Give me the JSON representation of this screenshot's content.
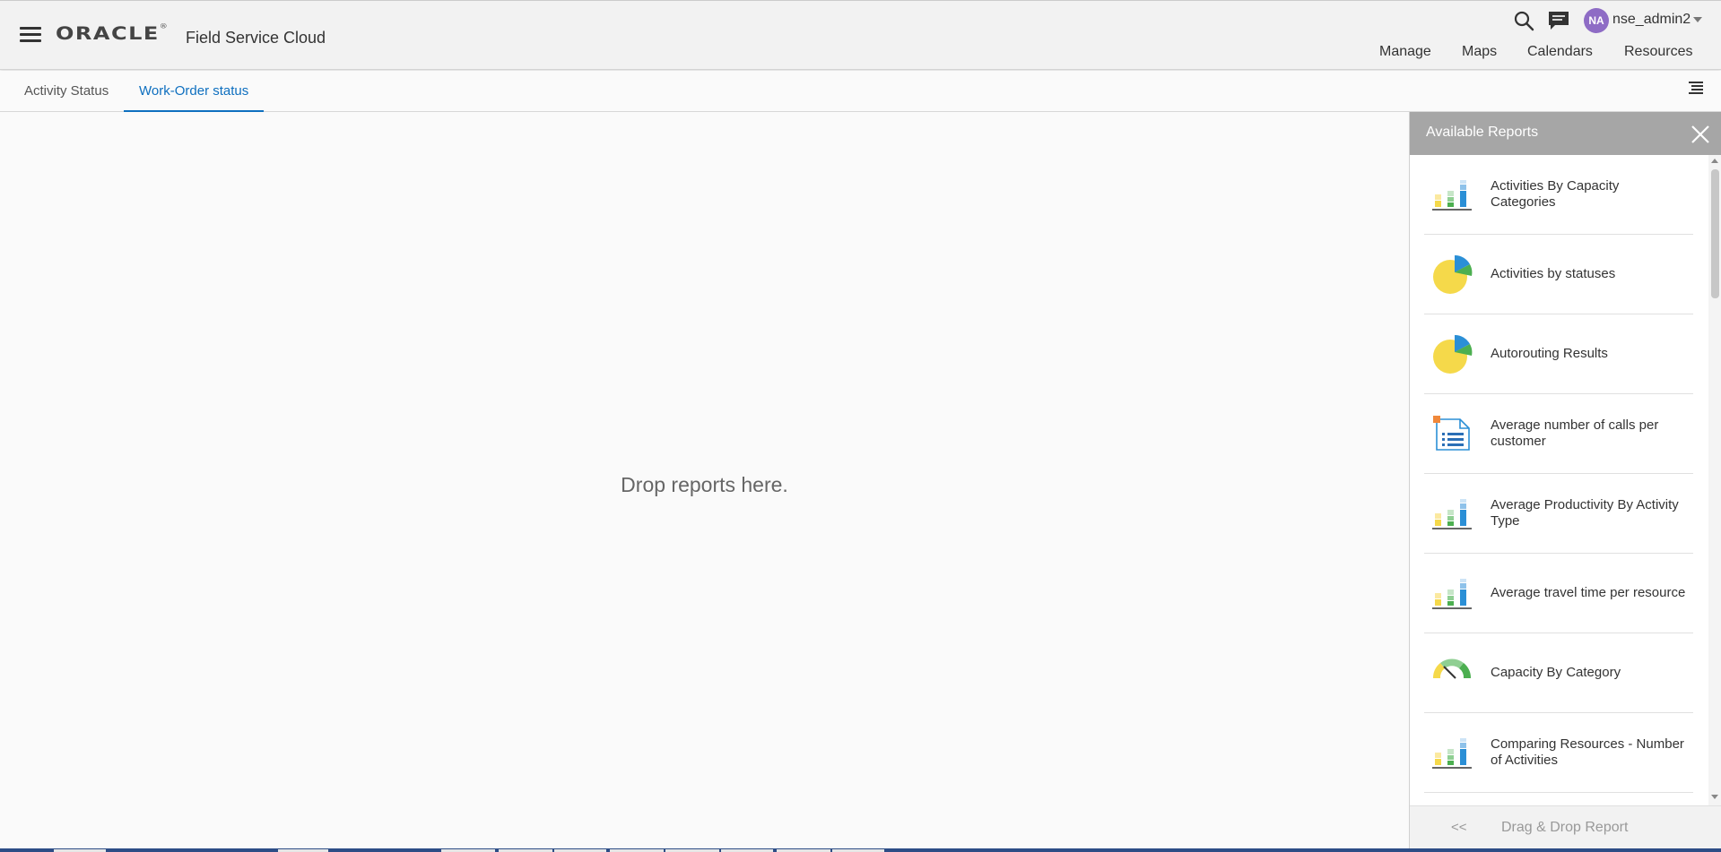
{
  "header": {
    "logo_text": "ORACLE",
    "logo_mark": "®",
    "product_name": "Field Service Cloud",
    "avatar_initials": "NA",
    "username": "nse_admin2",
    "nav": [
      {
        "label": "Manage"
      },
      {
        "label": "Maps"
      },
      {
        "label": "Calendars"
      },
      {
        "label": "Resources"
      }
    ]
  },
  "tabs": [
    {
      "label": "Activity Status",
      "active": false
    },
    {
      "label": "Work-Order status",
      "active": true
    }
  ],
  "drop_area": {
    "placeholder": "Drop reports here."
  },
  "panel": {
    "title": "Available Reports",
    "reports": [
      {
        "label": "Activities By Capacity Categories",
        "icon": "bar-chart-icon"
      },
      {
        "label": "Activities by statuses",
        "icon": "pie-chart-icon"
      },
      {
        "label": "Autorouting Results",
        "icon": "pie-chart-icon"
      },
      {
        "label": "Average number of calls per customer",
        "icon": "document-list-icon"
      },
      {
        "label": "Average Productivity By Activity Type",
        "icon": "bar-chart-icon"
      },
      {
        "label": "Average travel time per resource",
        "icon": "bar-chart-icon"
      },
      {
        "label": "Capacity By Category",
        "icon": "gauge-icon"
      },
      {
        "label": "Comparing Resources - Number of Activities",
        "icon": "bar-chart-icon"
      }
    ],
    "footer_back": "<<",
    "footer_hint": "Drag & Drop Report"
  },
  "colors": {
    "accent": "#0e6fbf",
    "avatar": "#8e6cc5",
    "panel_header": "#a6a6a6",
    "chart_yellow": "#f5d94a",
    "chart_green": "#4caf50",
    "chart_blue": "#2b8fd6"
  }
}
